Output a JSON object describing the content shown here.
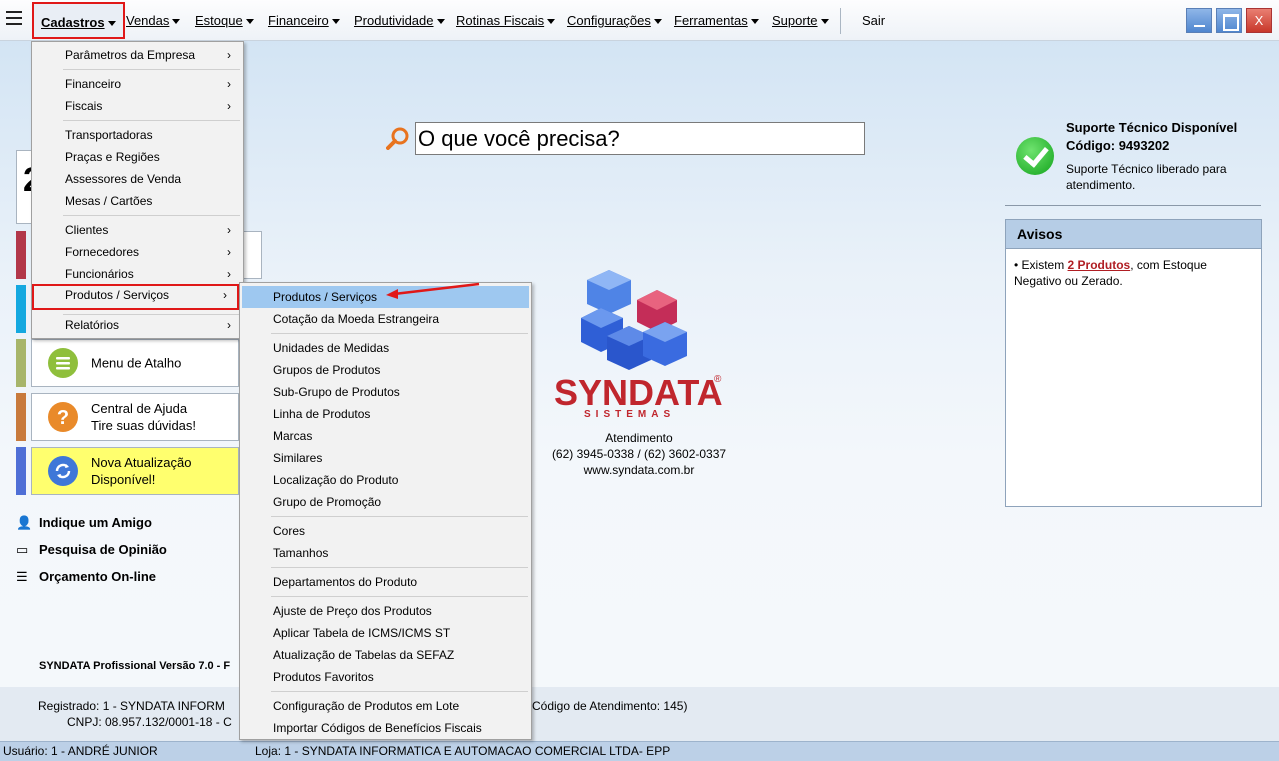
{
  "menubar": {
    "items": [
      {
        "label": "Cadastros"
      },
      {
        "label": "Vendas"
      },
      {
        "label": "Estoque"
      },
      {
        "label": "Financeiro"
      },
      {
        "label": "Produtividade"
      },
      {
        "label": "Rotinas Fiscais"
      },
      {
        "label": "Configurações"
      },
      {
        "label": "Ferramentas"
      },
      {
        "label": "Suporte"
      }
    ],
    "exit_label": "Sair",
    "window_controls": {
      "close": "X"
    }
  },
  "search": {
    "placeholder": "O que você precisa?"
  },
  "cadastros_menu": {
    "items": [
      {
        "label": "Parâmetros da Empresa",
        "submenu": true
      },
      {
        "label": "Financeiro",
        "submenu": true
      },
      {
        "label": "Fiscais",
        "submenu": true
      },
      {
        "label": "Transportadoras",
        "submenu": false
      },
      {
        "label": "Praças e Regiões",
        "submenu": false
      },
      {
        "label": "Assessores de Venda",
        "submenu": false
      },
      {
        "label": "Mesas / Cartões",
        "submenu": false
      },
      {
        "label": "Clientes",
        "submenu": true
      },
      {
        "label": "Fornecedores",
        "submenu": true
      },
      {
        "label": "Funcionários",
        "submenu": true
      },
      {
        "label": "Produtos / Serviços",
        "submenu": true,
        "active": true
      },
      {
        "label": "Relatórios",
        "submenu": true
      }
    ]
  },
  "produtos_menu": {
    "items": [
      {
        "label": "Produtos / Serviços",
        "highlighted": true
      },
      {
        "label": "Cotação da Moeda Estrangeira"
      },
      {
        "label": "Unidades de Medidas"
      },
      {
        "label": "Grupos de Produtos"
      },
      {
        "label": "Sub-Grupo de Produtos"
      },
      {
        "label": "Linha de Produtos"
      },
      {
        "label": "Marcas"
      },
      {
        "label": "Similares"
      },
      {
        "label": "Localização do Produto"
      },
      {
        "label": "Grupo de Promoção"
      },
      {
        "label": "Cores"
      },
      {
        "label": "Tamanhos"
      },
      {
        "label": "Departamentos do Produto"
      },
      {
        "label": "Ajuste de Preço dos Produtos"
      },
      {
        "label": "Aplicar Tabela de ICMS/ICMS ST"
      },
      {
        "label": "Atualização de Tabelas da SEFAZ"
      },
      {
        "label": "Produtos Favoritos"
      },
      {
        "label": "Configuração de Produtos em Lote"
      },
      {
        "label": "Importar Códigos de Benefícios Fiscais"
      }
    ]
  },
  "left_panel": {
    "partial_char": "2",
    "shortcut_buttons": [
      {
        "lines": [
          "Menu de Atalho"
        ],
        "icon": "menu-lines-icon",
        "bar_color": "#a7b56a"
      },
      {
        "lines": [
          "Central de Ajuda",
          "Tire suas dúvidas!"
        ],
        "icon": "question-icon",
        "bar_color": "#c87a3c"
      },
      {
        "lines": [
          "Nova Atualização",
          "Disponível!"
        ],
        "icon": "refresh-icon",
        "bar_color": "#4f6fd6"
      }
    ],
    "links": [
      {
        "label": "Indique um Amigo",
        "icon": "person-icon"
      },
      {
        "label": "Pesquisa de Opinião",
        "icon": "chat-icon"
      },
      {
        "label": "Orçamento On-line",
        "icon": "form-icon"
      }
    ]
  },
  "brand": {
    "name": "SYNDATA",
    "registered": "®",
    "subtitle": "SISTEMAS",
    "contact_title": "Atendimento",
    "phones": "(62) 3945-0338 / (62) 3602-0337",
    "website": "www.syndata.com.br"
  },
  "support": {
    "title": "Suporte Técnico Disponível",
    "code_line": "Código: 9493202",
    "description": "Suporte Técnico liberado para atendimento."
  },
  "avisos": {
    "title": "Avisos",
    "text_before": "• Existem ",
    "link": "2 Produtos",
    "text_after": ", com Estoque Negativo ou Zerado."
  },
  "footer": {
    "version": "SYNDATA Profissional Versão 7.0 - F",
    "registered_left": "Registrado:  1 - SYNDATA INFORM",
    "registered_right": "Código de Atendimento: 145)",
    "cnpj": "CNPJ:  08.957.132/0001-18 - C"
  },
  "statusbar": {
    "user": "Usuário: 1 - ANDRÉ JUNIOR",
    "store": "Loja: 1 - SYNDATA INFORMATICA E AUTOMACAO COMERCIAL LTDA- EPP"
  },
  "colors": {
    "highlight_box": "#e01818",
    "menu_highlight": "#9ec8f0",
    "brand_red": "#c0262d",
    "avisos_header": "#b6cde6",
    "update_button_bg": "#ffff6e"
  }
}
